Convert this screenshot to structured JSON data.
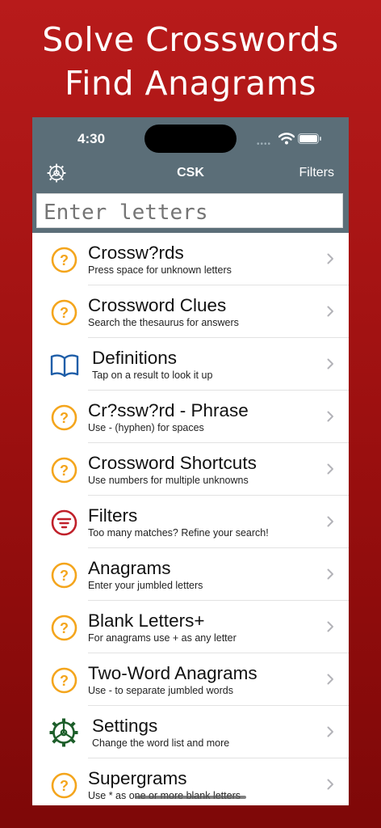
{
  "promo": {
    "line1": "Solve Crosswords",
    "line2": "Find Anagrams"
  },
  "status_bar": {
    "time": "4:30"
  },
  "nav": {
    "title": "CSK",
    "filters_label": "Filters",
    "settings_icon": "gear-icon"
  },
  "search": {
    "placeholder": "Enter letters",
    "value": ""
  },
  "colors": {
    "background": "#a41313",
    "nav_bar": "#5b6e78",
    "question_icon": "#f4a51c",
    "book_icon": "#1f5ea8",
    "filter_icon": "#c0202a",
    "settings_icon": "#1d5e2a"
  },
  "menu": [
    {
      "title": "Crossw?rds",
      "subtitle": "Press space for unknown letters",
      "icon": "question-circle-icon"
    },
    {
      "title": "Crossword Clues",
      "subtitle": "Search the thesaurus for answers",
      "icon": "question-circle-icon"
    },
    {
      "title": "Definitions",
      "subtitle": "Tap on a result to look it up",
      "icon": "book-icon"
    },
    {
      "title": "Cr?ssw?rd - Phrase",
      "subtitle": "Use - (hyphen) for spaces",
      "icon": "question-circle-icon"
    },
    {
      "title": "Crossword Shortcuts",
      "subtitle": "Use numbers for multiple unknowns",
      "icon": "question-circle-icon"
    },
    {
      "title": "Filters",
      "subtitle": "Too many matches? Refine your search!",
      "icon": "filter-icon"
    },
    {
      "title": "Anagrams",
      "subtitle": "Enter your jumbled letters",
      "icon": "question-circle-icon"
    },
    {
      "title": "Blank Letters+",
      "subtitle": "For anagrams use + as any letter",
      "icon": "question-circle-icon"
    },
    {
      "title": "Two-Word Anagrams",
      "subtitle": "Use - to separate jumbled words",
      "icon": "question-circle-icon"
    },
    {
      "title": "Settings",
      "subtitle": "Change the word list and more",
      "icon": "settings-gear-icon"
    },
    {
      "title": "Supergrams",
      "subtitle": "Use * as one or more blank letters",
      "icon": "question-circle-icon"
    }
  ]
}
